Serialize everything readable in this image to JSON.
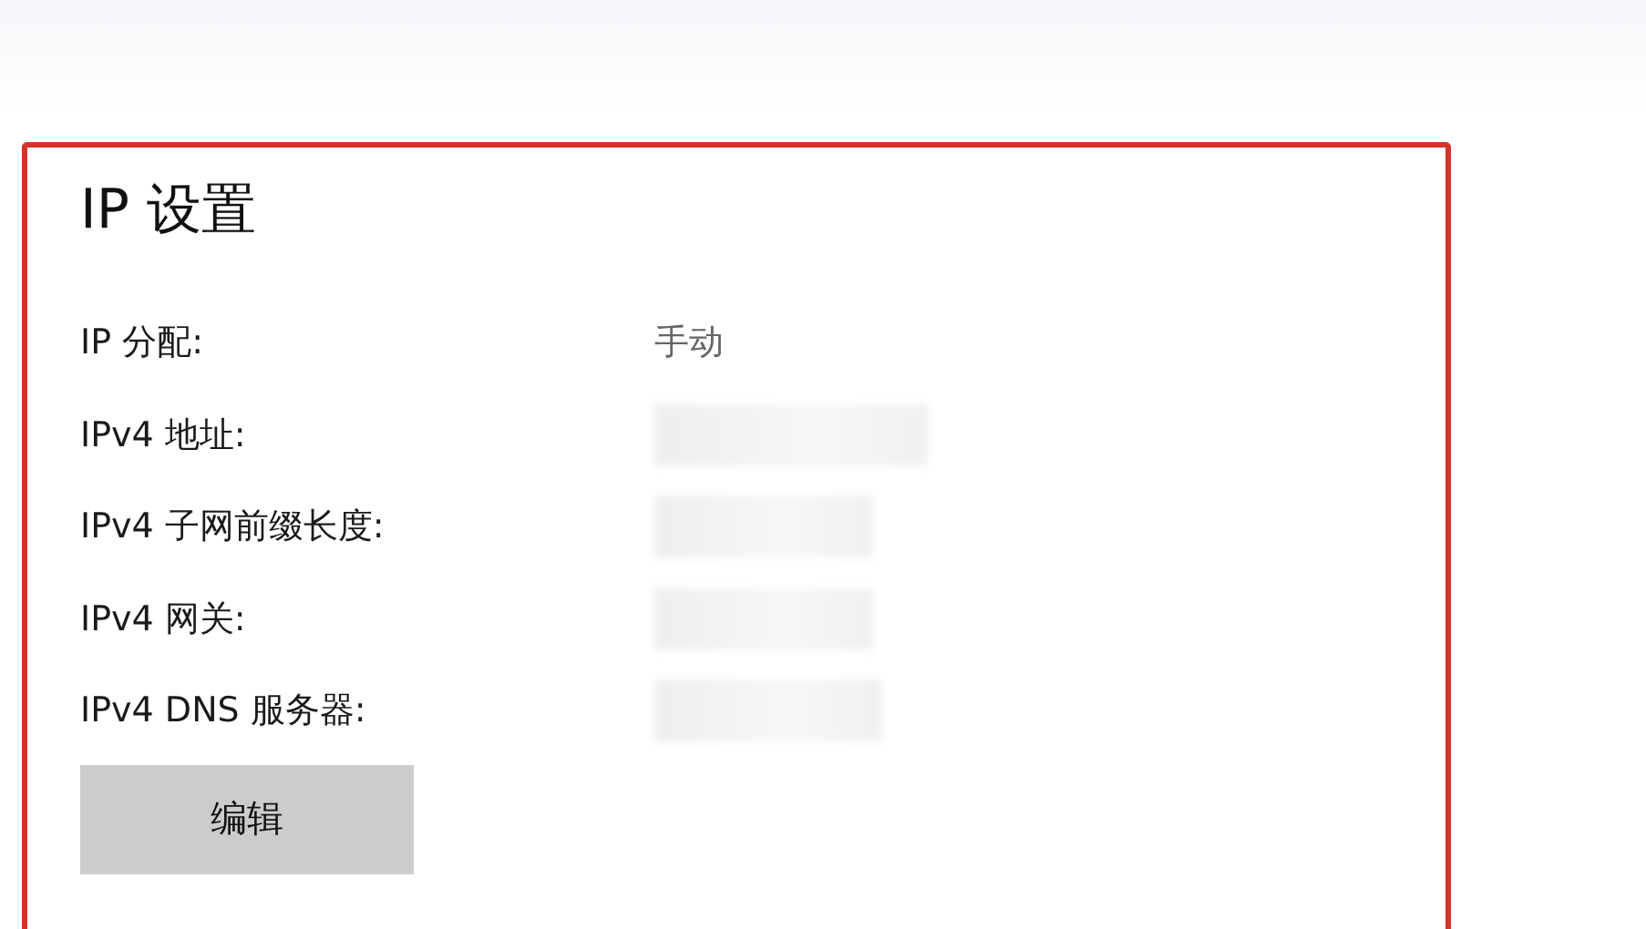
{
  "section": {
    "title": "IP 设置",
    "rows": [
      {
        "label": "IP 分配:",
        "value": "手动",
        "redacted": false
      },
      {
        "label": "IPv4 地址:",
        "redacted": true
      },
      {
        "label": "IPv4 子网前缀长度:",
        "redacted": true
      },
      {
        "label": "IPv4 网关:",
        "redacted": true
      },
      {
        "label": "IPv4 DNS 服务器:",
        "redacted": true
      }
    ],
    "button": "编辑"
  }
}
